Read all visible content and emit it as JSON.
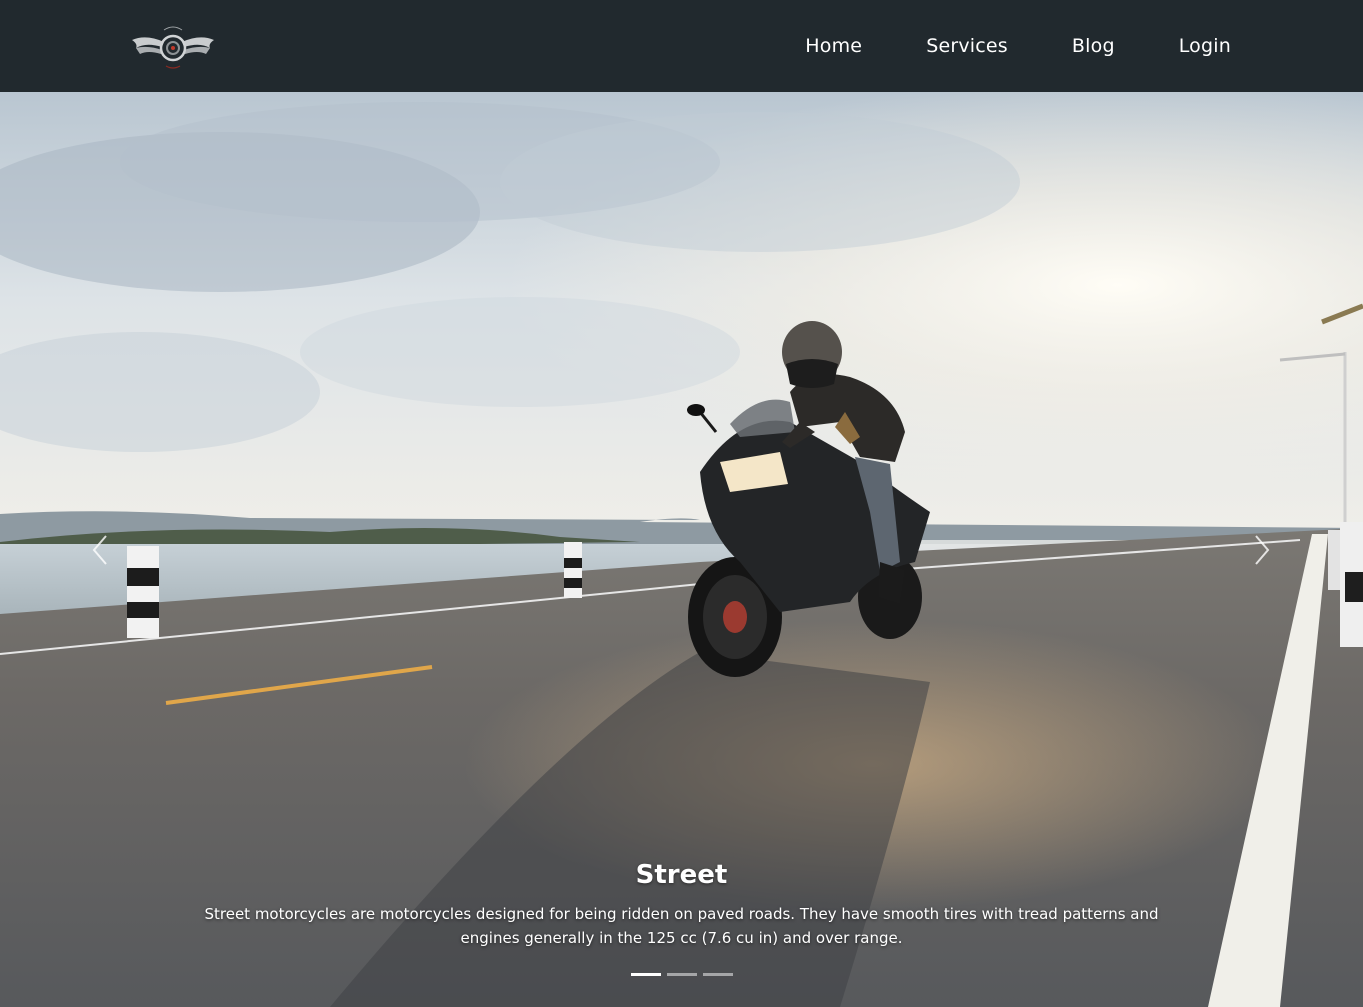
{
  "brand": {
    "logo_icon": "winged-wheel-logo"
  },
  "nav": {
    "items": [
      {
        "label": "Home"
      },
      {
        "label": "Services"
      },
      {
        "label": "Blog"
      },
      {
        "label": "Login"
      }
    ]
  },
  "carousel": {
    "slide": {
      "title": "Street",
      "text": "Street motorcycles are motorcycles designed for being ridden on paved roads. They have smooth tires with tread patterns and engines generally in the 125 cc (7.6 cu in) and over range."
    },
    "prev_icon": "chevron-left-icon",
    "next_icon": "chevron-right-icon",
    "slide_count": 3,
    "active_index": 0
  },
  "colors": {
    "navbar_bg": "#21292e",
    "nav_text": "#ffffff"
  }
}
